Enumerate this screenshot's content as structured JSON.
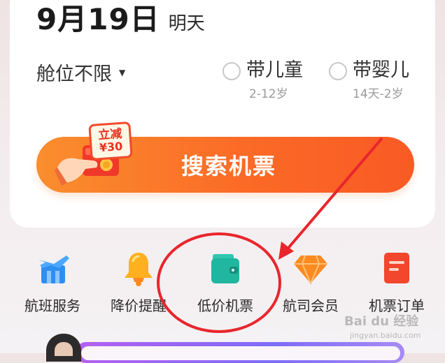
{
  "date": {
    "main": "9月19日",
    "relative": "明天"
  },
  "cabin": {
    "label": "舱位不限"
  },
  "options": [
    {
      "label": "带儿童",
      "sub": "2-12岁"
    },
    {
      "label": "带婴儿",
      "sub": "14天-2岁"
    }
  ],
  "promo": {
    "line1": "立减",
    "line2": "¥30"
  },
  "search": {
    "label": "搜索机票"
  },
  "nav": [
    {
      "label": "航班服务",
      "icon": "plane-building-icon"
    },
    {
      "label": "降价提醒",
      "icon": "bell-icon"
    },
    {
      "label": "低价机票",
      "icon": "wallet-icon"
    },
    {
      "label": "航司会员",
      "icon": "diamond-icon"
    },
    {
      "label": "机票订单",
      "icon": "order-icon"
    }
  ],
  "watermark": {
    "main": "Bai du 经验",
    "sub": "jingyan.baidu.com"
  },
  "colors": {
    "accent": "#fb6a27",
    "annotation": "#e8262c"
  }
}
